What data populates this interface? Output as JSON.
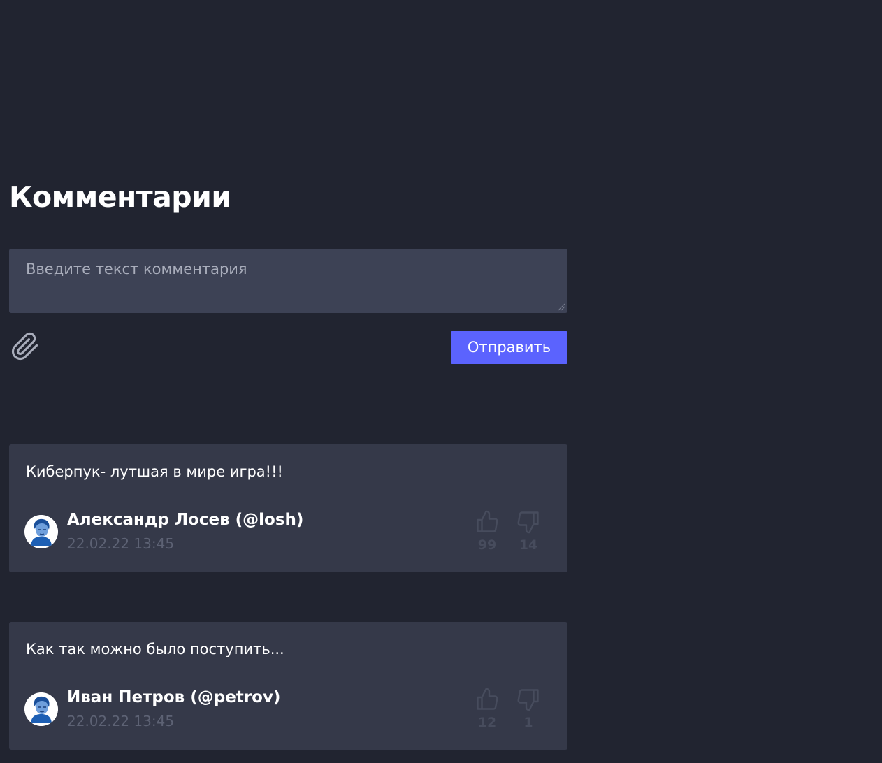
{
  "page": {
    "title": "Комментарии"
  },
  "comment_form": {
    "placeholder": "Введите текст комментария",
    "value": "",
    "send_label": "Отправить"
  },
  "comments": [
    {
      "text": "Киберпук- лутшая в мире игра!!!",
      "author": "Александр Лосев (@losh)",
      "date": "22.02.22 13:45",
      "likes": "99",
      "dislikes": "14"
    },
    {
      "text": "Как так можно было поступить...",
      "author": "Иван Петров (@petrov)",
      "date": "22.02.22 13:45",
      "likes": "12",
      "dislikes": "1"
    }
  ],
  "icons": {
    "attach": "paperclip-icon",
    "like": "thumbs-up-icon",
    "dislike": "thumbs-down-icon",
    "resize": "resize-grip-icon"
  },
  "colors": {
    "background": "#212430",
    "input_background": "#3d4255",
    "card_background": "#353949",
    "accent": "#5b63fe",
    "muted_text": "#5d6274",
    "vote_icon": "#474c5d"
  }
}
